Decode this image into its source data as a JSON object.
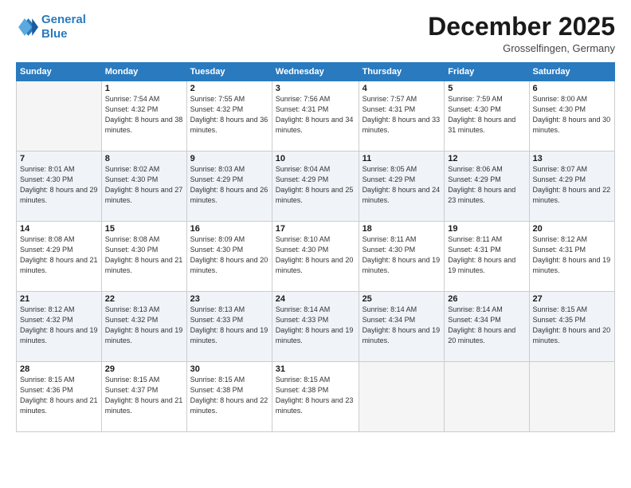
{
  "logo": {
    "line1": "General",
    "line2": "Blue"
  },
  "title": "December 2025",
  "location": "Grosselfingen, Germany",
  "weekdays": [
    "Sunday",
    "Monday",
    "Tuesday",
    "Wednesday",
    "Thursday",
    "Friday",
    "Saturday"
  ],
  "weeks": [
    [
      {
        "day": "",
        "empty": true
      },
      {
        "day": "1",
        "sunrise": "7:54 AM",
        "sunset": "4:32 PM",
        "daylight": "8 hours and 38 minutes."
      },
      {
        "day": "2",
        "sunrise": "7:55 AM",
        "sunset": "4:32 PM",
        "daylight": "8 hours and 36 minutes."
      },
      {
        "day": "3",
        "sunrise": "7:56 AM",
        "sunset": "4:31 PM",
        "daylight": "8 hours and 34 minutes."
      },
      {
        "day": "4",
        "sunrise": "7:57 AM",
        "sunset": "4:31 PM",
        "daylight": "8 hours and 33 minutes."
      },
      {
        "day": "5",
        "sunrise": "7:59 AM",
        "sunset": "4:30 PM",
        "daylight": "8 hours and 31 minutes."
      },
      {
        "day": "6",
        "sunrise": "8:00 AM",
        "sunset": "4:30 PM",
        "daylight": "8 hours and 30 minutes."
      }
    ],
    [
      {
        "day": "7",
        "sunrise": "8:01 AM",
        "sunset": "4:30 PM",
        "daylight": "8 hours and 29 minutes."
      },
      {
        "day": "8",
        "sunrise": "8:02 AM",
        "sunset": "4:30 PM",
        "daylight": "8 hours and 27 minutes."
      },
      {
        "day": "9",
        "sunrise": "8:03 AM",
        "sunset": "4:29 PM",
        "daylight": "8 hours and 26 minutes."
      },
      {
        "day": "10",
        "sunrise": "8:04 AM",
        "sunset": "4:29 PM",
        "daylight": "8 hours and 25 minutes."
      },
      {
        "day": "11",
        "sunrise": "8:05 AM",
        "sunset": "4:29 PM",
        "daylight": "8 hours and 24 minutes."
      },
      {
        "day": "12",
        "sunrise": "8:06 AM",
        "sunset": "4:29 PM",
        "daylight": "8 hours and 23 minutes."
      },
      {
        "day": "13",
        "sunrise": "8:07 AM",
        "sunset": "4:29 PM",
        "daylight": "8 hours and 22 minutes."
      }
    ],
    [
      {
        "day": "14",
        "sunrise": "8:08 AM",
        "sunset": "4:29 PM",
        "daylight": "8 hours and 21 minutes."
      },
      {
        "day": "15",
        "sunrise": "8:08 AM",
        "sunset": "4:30 PM",
        "daylight": "8 hours and 21 minutes."
      },
      {
        "day": "16",
        "sunrise": "8:09 AM",
        "sunset": "4:30 PM",
        "daylight": "8 hours and 20 minutes."
      },
      {
        "day": "17",
        "sunrise": "8:10 AM",
        "sunset": "4:30 PM",
        "daylight": "8 hours and 20 minutes."
      },
      {
        "day": "18",
        "sunrise": "8:11 AM",
        "sunset": "4:30 PM",
        "daylight": "8 hours and 19 minutes."
      },
      {
        "day": "19",
        "sunrise": "8:11 AM",
        "sunset": "4:31 PM",
        "daylight": "8 hours and 19 minutes."
      },
      {
        "day": "20",
        "sunrise": "8:12 AM",
        "sunset": "4:31 PM",
        "daylight": "8 hours and 19 minutes."
      }
    ],
    [
      {
        "day": "21",
        "sunrise": "8:12 AM",
        "sunset": "4:32 PM",
        "daylight": "8 hours and 19 minutes."
      },
      {
        "day": "22",
        "sunrise": "8:13 AM",
        "sunset": "4:32 PM",
        "daylight": "8 hours and 19 minutes."
      },
      {
        "day": "23",
        "sunrise": "8:13 AM",
        "sunset": "4:33 PM",
        "daylight": "8 hours and 19 minutes."
      },
      {
        "day": "24",
        "sunrise": "8:14 AM",
        "sunset": "4:33 PM",
        "daylight": "8 hours and 19 minutes."
      },
      {
        "day": "25",
        "sunrise": "8:14 AM",
        "sunset": "4:34 PM",
        "daylight": "8 hours and 19 minutes."
      },
      {
        "day": "26",
        "sunrise": "8:14 AM",
        "sunset": "4:34 PM",
        "daylight": "8 hours and 20 minutes."
      },
      {
        "day": "27",
        "sunrise": "8:15 AM",
        "sunset": "4:35 PM",
        "daylight": "8 hours and 20 minutes."
      }
    ],
    [
      {
        "day": "28",
        "sunrise": "8:15 AM",
        "sunset": "4:36 PM",
        "daylight": "8 hours and 21 minutes."
      },
      {
        "day": "29",
        "sunrise": "8:15 AM",
        "sunset": "4:37 PM",
        "daylight": "8 hours and 21 minutes."
      },
      {
        "day": "30",
        "sunrise": "8:15 AM",
        "sunset": "4:38 PM",
        "daylight": "8 hours and 22 minutes."
      },
      {
        "day": "31",
        "sunrise": "8:15 AM",
        "sunset": "4:38 PM",
        "daylight": "8 hours and 23 minutes."
      },
      {
        "day": "",
        "empty": true
      },
      {
        "day": "",
        "empty": true
      },
      {
        "day": "",
        "empty": true
      }
    ]
  ]
}
